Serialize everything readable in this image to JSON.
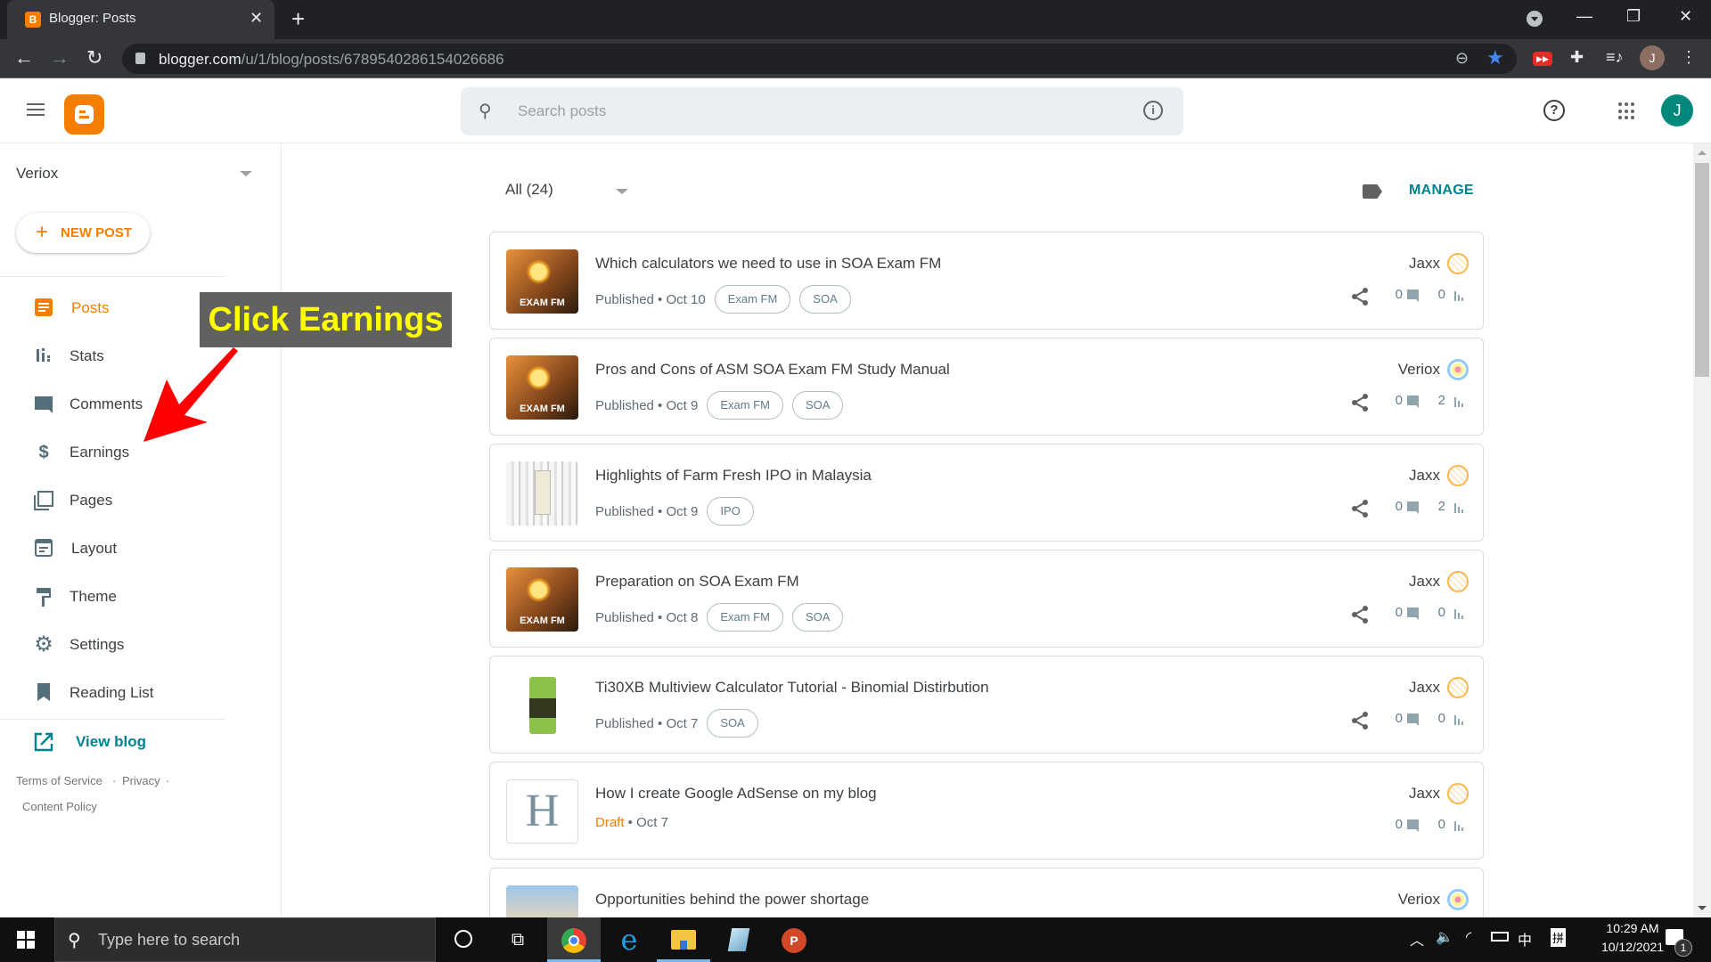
{
  "browser": {
    "tab_title": "Blogger: Posts",
    "tab_favicon": "B",
    "url_domain": "blogger.com",
    "url_path": "/u/1/blog/posts/6789540286154026686",
    "profile_initial": "J"
  },
  "header": {
    "search_placeholder": "Search posts",
    "account_initial": "J",
    "help_glyph": "?",
    "info_glyph": "i"
  },
  "sidebar": {
    "blog_name": "Veriox",
    "new_post_label": "NEW POST",
    "items": [
      {
        "label": "Posts",
        "icon": "posts-icon",
        "active": true
      },
      {
        "label": "Stats",
        "icon": "stats-icon"
      },
      {
        "label": "Comments",
        "icon": "comments-icon"
      },
      {
        "label": "Earnings",
        "icon": "dollar-icon"
      },
      {
        "label": "Pages",
        "icon": "pages-icon"
      },
      {
        "label": "Layout",
        "icon": "layout-icon"
      },
      {
        "label": "Theme",
        "icon": "paint-roller-icon"
      },
      {
        "label": "Settings",
        "icon": "gear-icon"
      },
      {
        "label": "Reading List",
        "icon": "bookmark-icon"
      }
    ],
    "view_blog_label": "View blog",
    "footer": {
      "terms": "Terms of Service",
      "privacy": "Privacy",
      "content_policy": "Content Policy",
      "separator": "·"
    }
  },
  "annotation": {
    "text": "Click Earnings",
    "color": "#ffff00"
  },
  "main": {
    "filter_label": "All (24)",
    "manage_label": "MANAGE",
    "posts": [
      {
        "title": "Which calculators we need to use in SOA Exam FM",
        "status": "Published",
        "date": "Oct 10",
        "labels": [
          "Exam FM",
          "SOA"
        ],
        "author": "Jaxx",
        "comments": "0",
        "views": "0",
        "thumb": "examfm",
        "shareable": true
      },
      {
        "title": "Pros and Cons of ASM SOA Exam FM Study Manual",
        "status": "Published",
        "date": "Oct 9",
        "labels": [
          "Exam FM",
          "SOA"
        ],
        "author": "Veriox",
        "comments": "0",
        "views": "2",
        "thumb": "examfm",
        "shareable": true
      },
      {
        "title": "Highlights of Farm Fresh IPO in Malaysia",
        "status": "Published",
        "date": "Oct 9",
        "labels": [
          "IPO"
        ],
        "author": "Jaxx",
        "comments": "0",
        "views": "2",
        "thumb": "ipo",
        "shareable": true
      },
      {
        "title": "Preparation on SOA Exam FM",
        "status": "Published",
        "date": "Oct 8",
        "labels": [
          "Exam FM",
          "SOA"
        ],
        "author": "Jaxx",
        "comments": "0",
        "views": "0",
        "thumb": "examfm",
        "shareable": true
      },
      {
        "title": "Ti30XB Multiview Calculator Tutorial - Binomial Distirbution",
        "status": "Published",
        "date": "Oct 7",
        "labels": [
          "SOA"
        ],
        "author": "Jaxx",
        "comments": "0",
        "views": "0",
        "thumb": "calc",
        "shareable": true
      },
      {
        "title": "How I create Google AdSense on my blog",
        "status": "Draft",
        "date": "Oct 7",
        "labels": [],
        "author": "Jaxx",
        "comments": "0",
        "views": "0",
        "thumb": "letter",
        "thumb_letter": "H",
        "shareable": false
      },
      {
        "title": "Opportunities behind the power shortage",
        "status": "",
        "date": "",
        "labels": [],
        "author": "Veriox",
        "comments": "",
        "views": "",
        "thumb": "power",
        "shareable": false
      }
    ],
    "thumb_examfm_text": "EXAM FM"
  },
  "taskbar": {
    "search_placeholder": "Type here to search",
    "time": "10:29 AM",
    "date": "10/12/2021",
    "notification_count": "1",
    "ime_label": "中",
    "ime_mode": "拼"
  },
  "colors": {
    "brand_orange": "#f57d00",
    "teal_link": "#00838f",
    "avatar_green": "#00897b"
  }
}
